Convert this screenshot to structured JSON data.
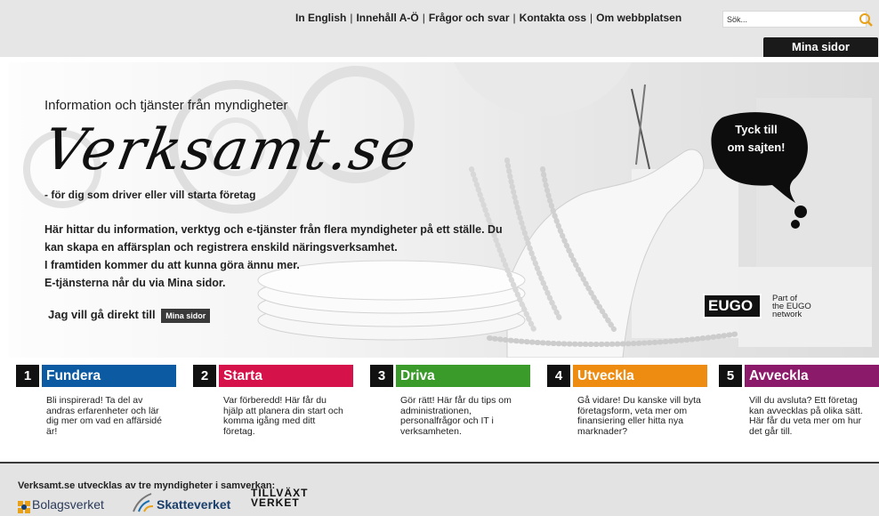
{
  "header": {
    "links": [
      "In English",
      "Innehåll A-Ö",
      "Frågor och svar",
      "Kontakta oss",
      "Om webbplatsen"
    ],
    "search_placeholder": "Sök...",
    "mina_sidor": "Mina sidor"
  },
  "hero": {
    "pretitle": "Information och tjänster från myndigheter",
    "logo": "Verksamt.se",
    "tagline": "- för dig som driver eller vill starta företag",
    "body": [
      "Här hittar du information, verktyg och e-tjänster från flera myndigheter på ett ställe. Du kan skapa en affärsplan och registrera enskild näringsverksamhet.",
      "I framtiden kommer du att kunna göra ännu mer.",
      "E-tjänsterna når du via Mina sidor."
    ],
    "direct_label": "Jag vill gå direkt till",
    "direct_button": "Mina sidor",
    "bubble": [
      "Tyck till",
      "om sajten!"
    ],
    "eugo_logo": "EUGO",
    "eugo_note": [
      "Part of",
      "the EUGO",
      "network"
    ]
  },
  "steps": [
    {
      "num": "1",
      "title": "Fundera",
      "color": "#0b5aa2",
      "desc": "Bli inspirerad!  Ta del av andras erfarenheter och lär dig mer om vad en affärsidé är!"
    },
    {
      "num": "2",
      "title": "Starta",
      "color": "#d6124b",
      "desc": "Var förberedd! Här får du hjälp att planera din start och komma igång med ditt företag."
    },
    {
      "num": "3",
      "title": "Driva",
      "color": "#3a9a2a",
      "desc": "Gör rätt! Här får du tips om administrationen, personalfrågor och IT i verksamheten."
    },
    {
      "num": "4",
      "title": "Utveckla",
      "color": "#ee8c12",
      "desc": "Gå vidare! Du kanske vill byta företagsform, veta mer om finansiering eller hitta nya marknader?"
    },
    {
      "num": "5",
      "title": "Avveckla",
      "color": "#8c1a6a",
      "desc": "Vill du avsluta? Ett företag kan avvecklas på olika sätt. Här får du veta mer om hur det går till."
    }
  ],
  "footer": {
    "title": "Verksamt.se utvecklas av tre myndigheter i samverkan:",
    "orgs": [
      "Bolagsverket",
      "Skatteverket",
      "TILLVÄXT VERKET"
    ]
  }
}
